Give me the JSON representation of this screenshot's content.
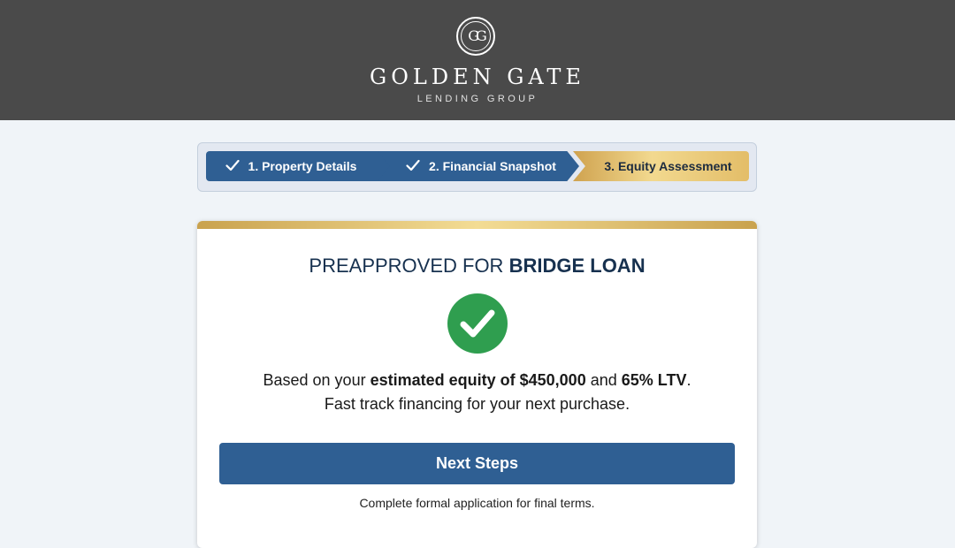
{
  "brand": {
    "monogram": "GG",
    "name": "GOLDEN GATE",
    "subtitle": "LENDING GROUP"
  },
  "steps": [
    {
      "label": "1. Property Details",
      "status": "complete",
      "icon": "check-icon"
    },
    {
      "label": "2. Financial Snapshot",
      "status": "complete",
      "icon": "check-icon"
    },
    {
      "label": "3. Equity Assessment",
      "status": "current"
    }
  ],
  "result": {
    "title_prefix": "PREAPPROVED FOR",
    "title_emphasis": "BRIDGE LOAN",
    "icon": "success-check-icon",
    "line1_prefix": "Based on your",
    "line1_equity": "estimated equity of $450,000",
    "line1_and": "and",
    "line1_ltv": "65% LTV",
    "line1_suffix": ".",
    "line2": "Fast track financing for your next purchase.",
    "button_label": "Next Steps",
    "note": "Complete formal application for final terms."
  },
  "colors": {
    "header": "#4a4a4a",
    "primary": "#2f5f93",
    "gold": "#e3bd68",
    "success": "#2f9e4f",
    "background": "#f0f4f8"
  }
}
